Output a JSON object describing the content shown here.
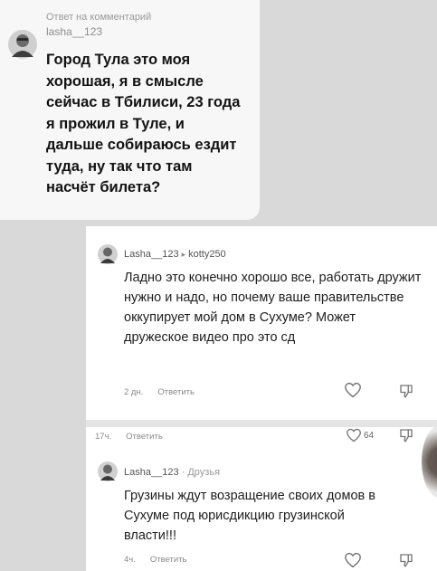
{
  "reply_bubble": {
    "header": "Ответ на комментарий",
    "username": "lasha__123",
    "text": "Город Тула это моя хорошая, я в смысле сейчас в Тбилиси, 23 года я прожил в Туле, и дальше собираюсь ездит туда, ну так что там насчёт билета?"
  },
  "comments": [
    {
      "username": "Lasha__123",
      "reply_to": "kotty250",
      "text": "Ладно это конечно хорошо все, работать дружит нужно и надо, но почему ваше правительстве оккупирует мой дом в Сухуме? Может дружеское видео про это сд",
      "time": "2 дн.",
      "reply_label": "Ответить"
    },
    {
      "time": "17ч.",
      "reply_label": "Ответить",
      "like_count": "64"
    },
    {
      "username": "Lasha__123",
      "tag": "· Друзья",
      "text": "Грузины ждут возращение своих домов в Сухуме под юрисдикцию грузинской власти!!!",
      "time": "4ч.",
      "reply_label": "Ответить"
    }
  ],
  "colors": {
    "bubble_bg": "#f7f7f7",
    "page_bg": "#d9d9d9",
    "panel_bg": "#ffffff"
  }
}
